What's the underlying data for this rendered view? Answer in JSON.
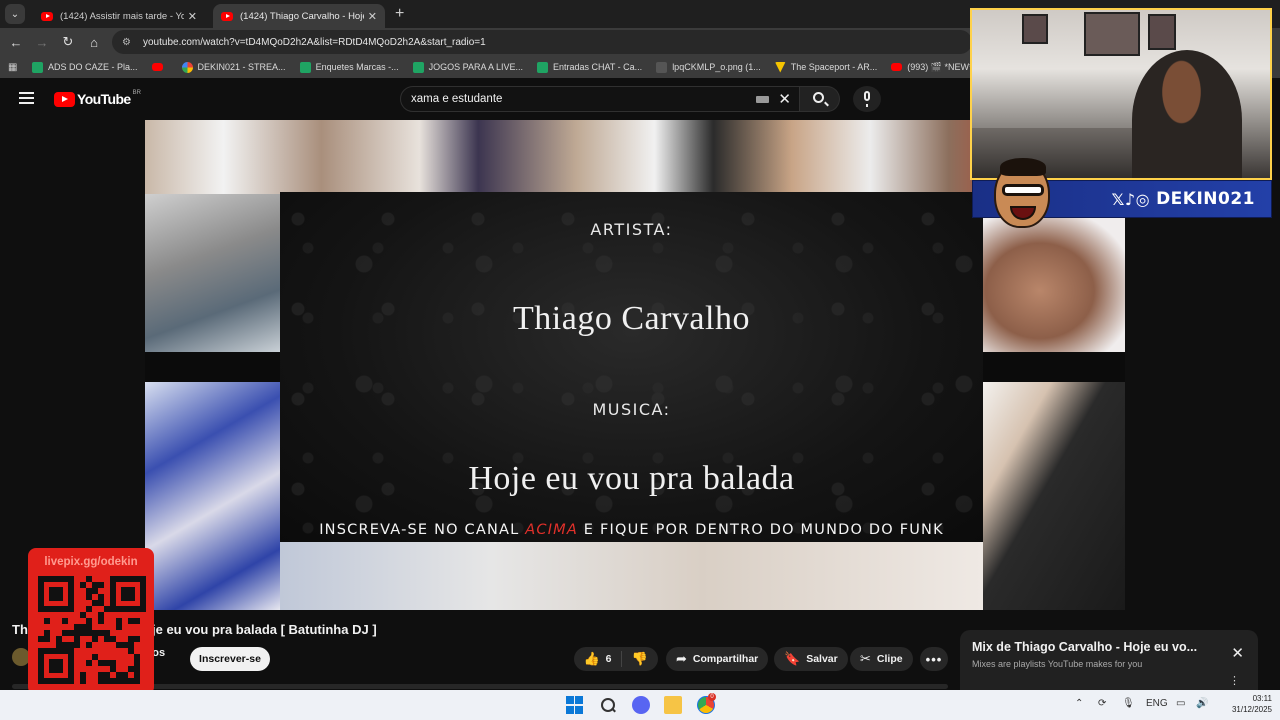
{
  "browser": {
    "tabs": [
      {
        "title": "(1424) Assistir mais tarde - You",
        "active": false
      },
      {
        "title": "(1424) Thiago Carvalho - Hoje e",
        "active": true
      }
    ],
    "url": "youtube.com/watch?v=tD4MQoD2h2A&list=RDtD4MQoD2h2A&start_radio=1",
    "bookmarks": [
      {
        "label": "ADS DO CAZE - Pla...",
        "icon": "sheets-icon"
      },
      {
        "label": "",
        "icon": "youtube-icon"
      },
      {
        "label": "DEKIN021 - STREA...",
        "icon": "google-icon"
      },
      {
        "label": "Enquetes Marcas -...",
        "icon": "sheets-icon"
      },
      {
        "label": "JOGOS PARA A LIVE...",
        "icon": "sheets-icon"
      },
      {
        "label": "Entradas CHAT - Ca...",
        "icon": "sheets-icon"
      },
      {
        "label": "lpqCKMLP_o.png (1...",
        "icon": "image-icon"
      },
      {
        "label": "The Spaceport - AR...",
        "icon": "spaceport-icon"
      },
      {
        "label": "(993) 🎬 *NEW* EXA...",
        "icon": "youtube-icon"
      }
    ]
  },
  "youtube": {
    "logo_text": "YouTube",
    "logo_region": "BR",
    "search_value": "xama e estudante",
    "video_card": {
      "artist_label": "ARTISTA:",
      "artist_name": "Thiago Carvalho",
      "music_label": "MUSICA:",
      "music_name": "Hoje eu vou pra balada",
      "cta_before": "INSCREVA-SE NO CANAL ",
      "cta_accent": "ACIMA",
      "cta_after": " E FIQUE POR DENTRO DO MUNDO DO FUNK"
    },
    "title_start": "Th",
    "title_rest": "je eu vou pra balada [ Batutinha DJ ]",
    "channel_tail": "ros",
    "subscribe_label": "Inscrever-se",
    "likes": "6",
    "share_label": "Compartilhar",
    "save_label": "Salvar",
    "clip_label": "Clipe",
    "more_label": "•••",
    "mix": {
      "title": "Mix de Thiago Carvalho - Hoje eu vo...",
      "subtitle": "Mixes are playlists YouTube makes for you"
    }
  },
  "overlay": {
    "livepix_url": "livepix.gg/odekin",
    "handle": "DEKIN021",
    "social_icons": "𝕏♪◎"
  },
  "taskbar": {
    "lang": "ENG",
    "time": "03:11",
    "date": "31/12/2025",
    "chrome_badge": "0"
  },
  "colors": {
    "youtube_red": "#ff0000",
    "accent_red": "#e0302a",
    "handle_blue": "#2340a8",
    "webcam_border": "#ffd24a"
  }
}
